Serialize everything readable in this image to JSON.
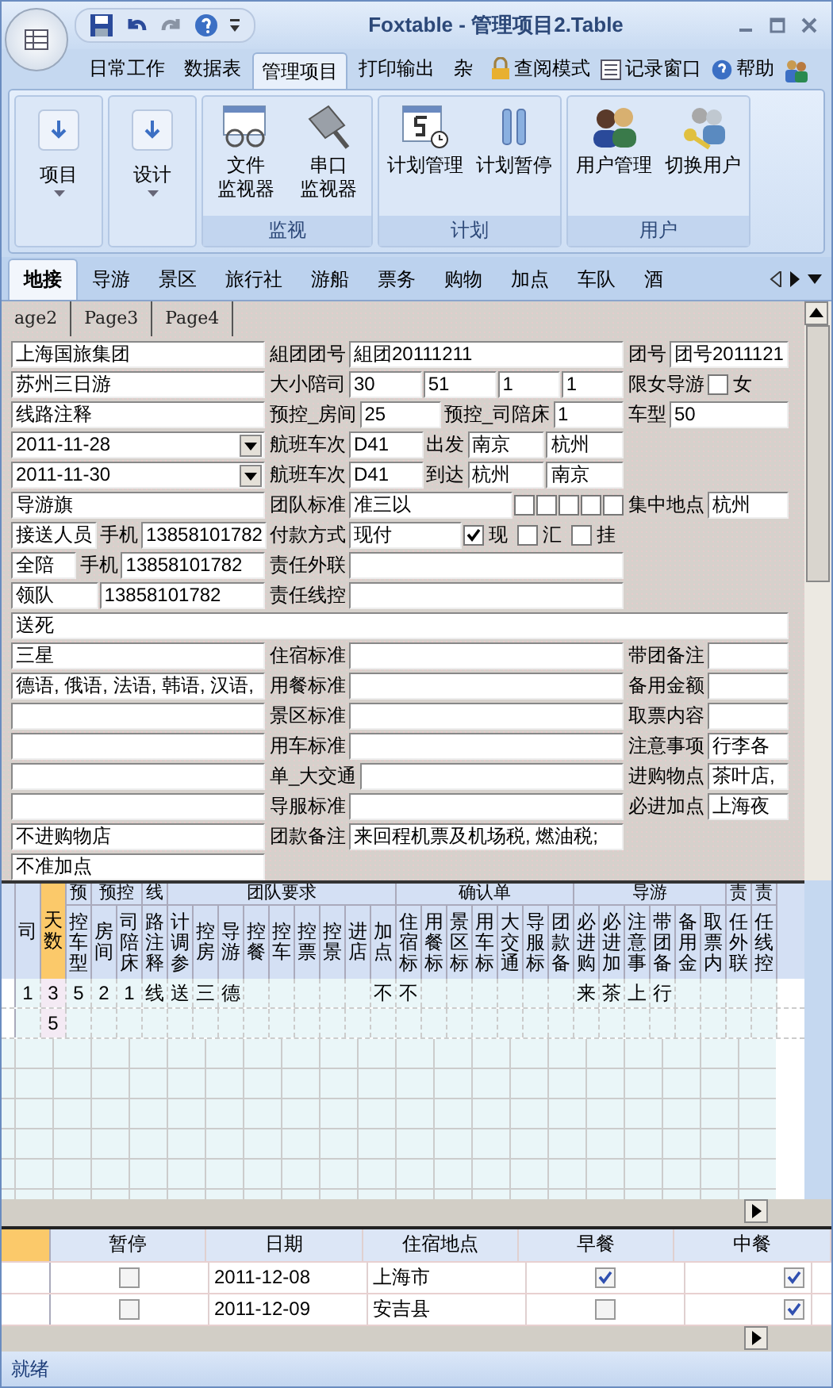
{
  "window": {
    "title": "Foxtable - 管理项目2.Table"
  },
  "menu_tabs": [
    {
      "label": "日常工作",
      "selected": false
    },
    {
      "label": "数据表",
      "selected": false
    },
    {
      "label": "管理项目",
      "selected": true
    },
    {
      "label": "打印输出",
      "selected": false
    },
    {
      "label": "杂",
      "selected": false
    }
  ],
  "menu_extras": [
    {
      "kind": "lock",
      "label": "查阅模式"
    },
    {
      "kind": "record",
      "label": "记录窗口"
    },
    {
      "kind": "help",
      "label": "帮助"
    },
    {
      "kind": "users"
    }
  ],
  "ribbon_groups": [
    {
      "buttons": [
        {
          "kind": "menu",
          "lines": [
            "项目"
          ]
        }
      ]
    },
    {
      "buttons": [
        {
          "kind": "menu",
          "lines": [
            "设计"
          ]
        }
      ]
    },
    {
      "title": "监视",
      "buttons": [
        {
          "kind": "file",
          "lines": [
            "文件",
            "监视器"
          ]
        },
        {
          "kind": "serial",
          "lines": [
            "串口",
            "监视器"
          ]
        }
      ]
    },
    {
      "title": "计划",
      "buttons": [
        {
          "kind": "calendar",
          "lines": [
            "计划管理"
          ]
        },
        {
          "kind": "pause",
          "lines": [
            "计划暂停"
          ]
        }
      ]
    },
    {
      "title": "用户",
      "buttons": [
        {
          "kind": "people",
          "lines": [
            "用户管理"
          ]
        },
        {
          "kind": "keys",
          "lines": [
            "切换用户"
          ]
        }
      ]
    }
  ],
  "form_tabs": [
    {
      "label": "地接",
      "selected": true
    },
    {
      "label": "导游",
      "selected": false
    },
    {
      "label": "景区",
      "selected": false
    },
    {
      "label": "旅行社",
      "selected": false
    },
    {
      "label": "游船",
      "selected": false
    },
    {
      "label": "票务",
      "selected": false
    },
    {
      "label": "购物",
      "selected": false
    },
    {
      "label": "加点",
      "selected": false
    },
    {
      "label": "车队",
      "selected": false
    },
    {
      "label": "酒",
      "selected": false
    }
  ],
  "pages": [
    {
      "label": "age2"
    },
    {
      "label": "Page3"
    },
    {
      "label": "Page4"
    }
  ],
  "form": {
    "rows": [
      {
        "left": [
          {
            "kind": "field",
            "value": "上海国旅集团"
          }
        ],
        "middle": [
          {
            "kind": "label",
            "text": "組团团号"
          },
          {
            "kind": "field",
            "value": "組团20111211"
          }
        ],
        "right": [
          {
            "kind": "label",
            "text": "团号"
          },
          {
            "kind": "field",
            "value": "团号2011121"
          }
        ]
      },
      {
        "left": [
          {
            "kind": "field",
            "value": "苏州三日游"
          }
        ],
        "middle": [
          {
            "kind": "label",
            "text": "大小陪司"
          },
          {
            "kind": "field",
            "value": "30"
          },
          {
            "kind": "field",
            "value": "51"
          },
          {
            "kind": "field",
            "value": "1"
          },
          {
            "kind": "field",
            "value": "1"
          }
        ],
        "right": [
          {
            "kind": "label",
            "text": "限女导游"
          },
          {
            "kind": "check",
            "checked": false,
            "text": "女"
          }
        ]
      },
      {
        "left": [
          {
            "kind": "field",
            "value": "线路注释"
          }
        ],
        "middle": [
          {
            "kind": "label",
            "text": "预控_房间"
          },
          {
            "kind": "field",
            "value": "25"
          },
          {
            "kind": "label",
            "text": "预控_司陪床"
          },
          {
            "kind": "field",
            "value": "1"
          }
        ],
        "right": [
          {
            "kind": "label",
            "text": "车型"
          },
          {
            "kind": "field",
            "value": "50"
          }
        ]
      },
      {
        "left": [
          {
            "kind": "combo",
            "value": "2011-11-28"
          }
        ],
        "middle": [
          {
            "kind": "label",
            "text": "航班车次"
          },
          {
            "kind": "field",
            "value": "D41"
          },
          {
            "kind": "label",
            "text": "出发"
          },
          {
            "kind": "field",
            "value": "南京"
          },
          {
            "kind": "field",
            "value": "杭州"
          }
        ]
      },
      {
        "left": [
          {
            "kind": "combo",
            "value": "2011-11-30"
          }
        ],
        "middle": [
          {
            "kind": "label",
            "text": "航班车次"
          },
          {
            "kind": "field",
            "value": "D41"
          },
          {
            "kind": "label",
            "text": "到达"
          },
          {
            "kind": "field",
            "value": "杭州"
          },
          {
            "kind": "field",
            "value": "南京"
          }
        ]
      },
      {
        "left": [
          {
            "kind": "field",
            "value": "导游旗"
          }
        ],
        "middle": [
          {
            "kind": "label",
            "text": "团队标准"
          },
          {
            "kind": "field",
            "value": "准三以"
          },
          {
            "kind": "check",
            "checked": false
          },
          {
            "kind": "check",
            "checked": false
          },
          {
            "kind": "check",
            "checked": false
          },
          {
            "kind": "check",
            "checked": false
          },
          {
            "kind": "check",
            "checked": false
          }
        ],
        "right": [
          {
            "kind": "label",
            "text": "集中地点"
          },
          {
            "kind": "field",
            "value": "杭州"
          }
        ]
      },
      {
        "left": [
          {
            "kind": "field",
            "value": "接送人员"
          },
          {
            "kind": "label",
            "text": "手机"
          },
          {
            "kind": "field",
            "value": "13858101782"
          }
        ],
        "middle": [
          {
            "kind": "label",
            "text": "付款方式"
          },
          {
            "kind": "field",
            "value": "现付"
          },
          {
            "kind": "check",
            "checked": true,
            "text": "现"
          },
          {
            "kind": "check",
            "checked": false,
            "text": "汇"
          },
          {
            "kind": "check",
            "checked": false,
            "text": "挂"
          }
        ]
      },
      {
        "left": [
          {
            "kind": "field",
            "value": "全陪"
          },
          {
            "kind": "label",
            "text": "手机"
          },
          {
            "kind": "field",
            "value": "13858101782"
          }
        ],
        "middle": [
          {
            "kind": "label",
            "text": "责任外联"
          },
          {
            "kind": "field"
          }
        ]
      },
      {
        "left": [
          {
            "kind": "field",
            "value": "领队"
          },
          {
            "kind": "field",
            "value": "13858101782"
          }
        ],
        "middle": [
          {
            "kind": "label",
            "text": "责任线控"
          },
          {
            "kind": "field"
          }
        ]
      },
      {
        "wide": {
          "kind": "field",
          "value": "送死"
        }
      },
      {
        "left": [
          {
            "kind": "field",
            "value": "三星"
          }
        ],
        "middle": [
          {
            "kind": "label",
            "text": "住宿标准"
          },
          {
            "kind": "field"
          }
        ],
        "right": [
          {
            "kind": "label",
            "text": "带团备注"
          },
          {
            "kind": "field"
          }
        ]
      },
      {
        "left": [
          {
            "kind": "field",
            "value": "德语, 俄语, 法语, 韩语, 汉语,"
          }
        ],
        "middle": [
          {
            "kind": "label",
            "text": "用餐标准"
          },
          {
            "kind": "field"
          }
        ],
        "right": [
          {
            "kind": "label",
            "text": "备用金额"
          },
          {
            "kind": "field"
          }
        ]
      },
      {
        "left": [
          {
            "kind": "field"
          }
        ],
        "middle": [
          {
            "kind": "label",
            "text": "景区标准"
          },
          {
            "kind": "field"
          }
        ],
        "right": [
          {
            "kind": "label",
            "text": "取票内容"
          },
          {
            "kind": "field"
          }
        ]
      },
      {
        "left": [
          {
            "kind": "field"
          }
        ],
        "middle": [
          {
            "kind": "label",
            "text": "用车标准"
          },
          {
            "kind": "field"
          }
        ],
        "right": [
          {
            "kind": "label",
            "text": "注意事项"
          },
          {
            "kind": "field",
            "value": "行李各"
          }
        ]
      },
      {
        "left": [
          {
            "kind": "field"
          }
        ],
        "middle": [
          {
            "kind": "label",
            "text": "单_大交通"
          },
          {
            "kind": "field"
          }
        ],
        "right": [
          {
            "kind": "label",
            "text": "进购物点"
          },
          {
            "kind": "field",
            "value": "茶叶店,"
          }
        ]
      },
      {
        "left": [
          {
            "kind": "field"
          }
        ],
        "middle": [
          {
            "kind": "label",
            "text": "导服标准"
          },
          {
            "kind": "field"
          }
        ],
        "right": [
          {
            "kind": "label",
            "text": "必进加点"
          },
          {
            "kind": "field",
            "value": "上海夜"
          }
        ]
      },
      {
        "left": [
          {
            "kind": "field",
            "value": "不进购物店"
          }
        ],
        "middle": [
          {
            "kind": "label",
            "text": "团款备注"
          },
          {
            "kind": "field",
            "value": "来回程机票及机场税, 燃油税;"
          }
        ]
      },
      {
        "left": [
          {
            "kind": "field",
            "value": "不准加点"
          }
        ]
      }
    ]
  },
  "grid": {
    "column_groups": [
      {
        "columns": [
          {
            "header": "司",
            "selected": false
          },
          {
            "header": "天数",
            "selected": true
          }
        ]
      },
      {
        "label": "预",
        "columns": [
          {
            "header": "控车型",
            "selected": false
          }
        ]
      },
      {
        "label": "预控",
        "columns": [
          {
            "header": "房间",
            "selected": false
          },
          {
            "header": "司陪床",
            "selected": false
          }
        ]
      },
      {
        "label": "线",
        "columns": [
          {
            "header": "路注释",
            "selected": false
          }
        ]
      },
      {
        "label": "团队要求",
        "columns": [
          {
            "header": "计调参",
            "selected": false
          },
          {
            "header": "控房",
            "selected": false
          },
          {
            "header": "导游",
            "selected": false
          },
          {
            "header": "控餐",
            "selected": false
          },
          {
            "header": "控车",
            "selected": false
          },
          {
            "header": "控票",
            "selected": false
          },
          {
            "header": "控景",
            "selected": false
          },
          {
            "header": "进店",
            "selected": false
          },
          {
            "header": "加点",
            "selected": false
          }
        ]
      },
      {
        "label": "确认单",
        "columns": [
          {
            "header": "住宿标",
            "selected": false
          },
          {
            "header": "用餐标",
            "selected": false
          },
          {
            "header": "景区标",
            "selected": false
          },
          {
            "header": "用车标",
            "selected": false
          },
          {
            "header": "大交通",
            "selected": false
          },
          {
            "header": "导服标",
            "selected": false
          },
          {
            "header": "团款备",
            "selected": false
          }
        ]
      },
      {
        "label": "导游",
        "columns": [
          {
            "header": "必进购",
            "selected": false
          },
          {
            "header": "必进加",
            "selected": false
          },
          {
            "header": "注意事",
            "selected": false
          },
          {
            "header": "带团备",
            "selected": false
          },
          {
            "header": "备用金",
            "selected": false
          },
          {
            "header": "取票内",
            "selected": false
          }
        ]
      },
      {
        "label": "责",
        "columns": [
          {
            "header": "任外联",
            "selected": false
          }
        ]
      },
      {
        "label": "责",
        "columns": [
          {
            "header": "任线控",
            "selected": false
          }
        ]
      }
    ],
    "rows": [
      {
        "cells": [
          "1",
          "3",
          "5",
          "2",
          "1",
          "线",
          "送",
          "三",
          "德",
          null,
          null,
          null,
          null,
          null,
          "不",
          "不",
          null,
          null,
          null,
          null,
          null,
          null,
          "来",
          "茶",
          "上",
          "行",
          null,
          null,
          null,
          null
        ]
      },
      {
        "cells": [
          null,
          "5",
          null,
          null,
          null,
          null,
          null,
          null,
          null,
          null,
          null,
          null,
          null,
          null,
          null,
          null,
          null,
          null,
          null,
          null,
          null,
          null,
          null,
          null,
          null,
          null,
          null,
          null,
          null,
          null
        ]
      }
    ]
  },
  "day_table": {
    "columns": [
      "暂停",
      "日期",
      "住宿地点",
      "早餐",
      "中餐"
    ],
    "rows": [
      {
        "paused": false,
        "date": "2011-12-08",
        "place": "上海市",
        "breakfast": true,
        "lunch": true
      },
      {
        "paused": false,
        "date": "2011-12-09",
        "place": "安吉县",
        "breakfast": false,
        "lunch": true
      }
    ]
  },
  "status_bar": {
    "text": "就绪"
  }
}
